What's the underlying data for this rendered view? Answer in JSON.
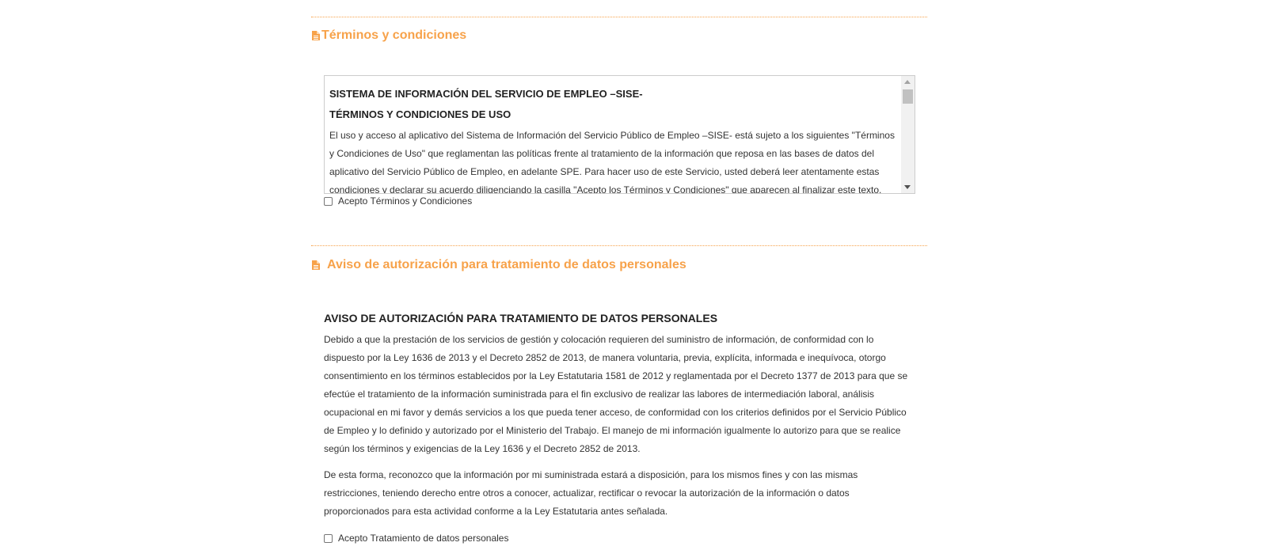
{
  "terms_section": {
    "title": "Términos y condiciones",
    "heading1": "SISTEMA DE INFORMACIÓN DEL SERVICIO DE EMPLEO –SISE-",
    "heading2": "TÉRMINOS Y CONDICIONES DE USO",
    "body": "El uso y acceso al aplicativo del Sistema de Información del Servicio Público de Empleo –SISE- está sujeto a los siguientes \"Términos y Condiciones de Uso\" que reglamentan las políticas frente al tratamiento de la información que reposa en las bases de datos del aplicativo del Servicio Público de Empleo, en adelante SPE. Para hacer uso de este Servicio, usted deberá leer atentamente estas condiciones y declarar su acuerdo diligenciando la casilla \"Acepto los Términos y Condiciones\" que aparecen al finalizar este texto.",
    "checkbox_label": "Acepto Términos y Condiciones"
  },
  "aviso_section": {
    "title": "Aviso de autorización para tratamiento de datos personales",
    "heading": "AVISO DE AUTORIZACIÓN PARA TRATAMIENTO DE DATOS PERSONALES",
    "paragraph1": "Debido a que la prestación de los servicios de gestión y colocación requieren del suministro de información, de conformidad con lo dispuesto por la Ley 1636 de 2013 y el Decreto 2852 de 2013, de manera voluntaria, previa, explícita, informada e inequívoca, otorgo consentimiento en los términos establecidos por la Ley Estatutaria 1581 de 2012 y reglamentada por el Decreto 1377 de 2013 para que se efectúe el tratamiento de la información suministrada para el fin exclusivo de realizar las labores de intermediación laboral, análisis ocupacional en mi favor y demás servicios a los que pueda tener acceso, de conformidad con los criterios definidos por el Servicio Público de Empleo y lo definido y autorizado por el Ministerio del Trabajo. El manejo de mi información igualmente lo autorizo para que se realice según los términos y exigencias de la Ley 1636 y el Decreto 2852 de 2013.",
    "paragraph2": "De esta forma, reconozco que la información por mi suministrada estará a disposición, para los mismos fines y con las mismas restricciones, teniendo derecho entre otros a conocer, actualizar, rectificar o revocar la autorización de la información o datos proporcionados para esta actividad conforme a la Ley Estatutaria antes señalada.",
    "checkbox_label": "Acepto Tratamiento de datos personales"
  },
  "icons": {
    "section_icon": "document-icon"
  },
  "colors": {
    "accent": "#f7a24a"
  }
}
